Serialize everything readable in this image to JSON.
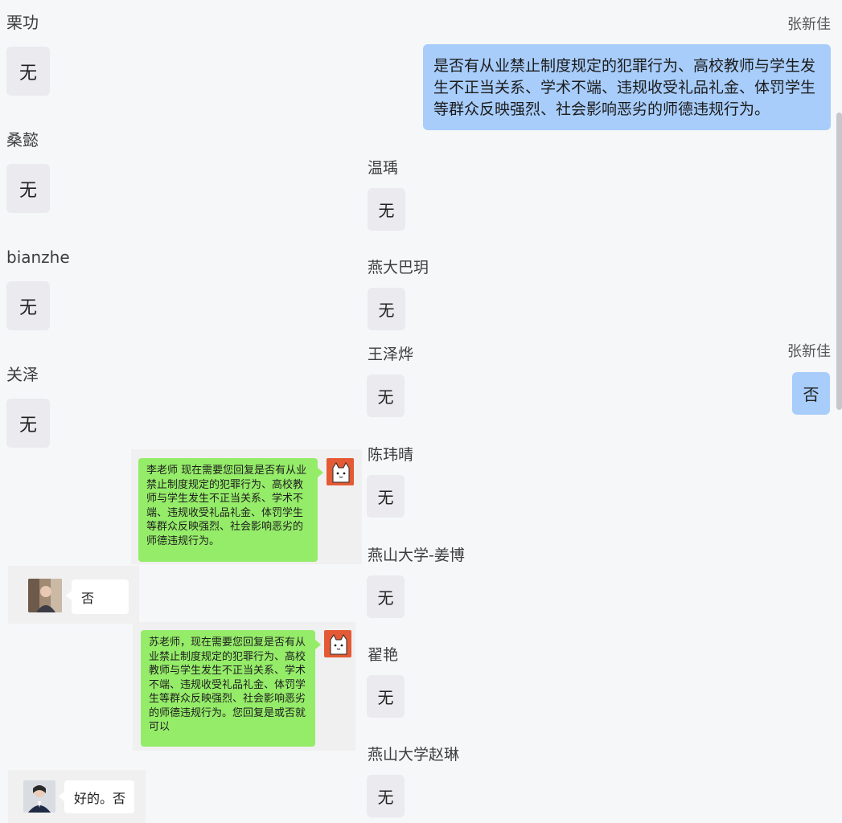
{
  "left_column": [
    {
      "name": "栗功",
      "reply": "无"
    },
    {
      "name": "桑懿",
      "reply": "无"
    },
    {
      "name": "bianzhe",
      "reply": "无"
    },
    {
      "name": "关泽",
      "reply": "无"
    }
  ],
  "middle_column": [
    {
      "name": "温瑀",
      "reply": "无"
    },
    {
      "name": "燕大巴玥",
      "reply": "无"
    },
    {
      "name": "王泽烨",
      "reply": "无"
    },
    {
      "name": "陈玮晴",
      "reply": "无"
    },
    {
      "name": "燕山大学-姜博",
      "reply": "无"
    },
    {
      "name": "翟艳",
      "reply": "无"
    },
    {
      "name": "燕山大学赵琳",
      "reply": "无"
    }
  ],
  "question_message": {
    "sender": "张新佳",
    "text": "是否有从业禁止制度规定的犯罪行为、高校教师与学生发生不正当关系、学术不端、违规收受礼品礼金、体罚学生等群众反映强烈、社会影响恶劣的师德违规行为。"
  },
  "answer_message": {
    "sender": "张新佳",
    "text": "否"
  },
  "screenshot_chats": [
    {
      "outgoing": "李老师 现在需要您回复是否有从业禁止制度规定的犯罪行为、高校教师与学生发生不正当关系、学术不端、违规收受礼品礼金、体罚学生等群众反映强烈、社会影响恶劣的师德违规行为。",
      "incoming": "否"
    },
    {
      "outgoing": "苏老师，现在需要您回复是否有从业禁止制度规定的犯罪行为、高校教师与学生发生不正当关系、学术不端、违规收受礼品礼金、体罚学生等群众反映强烈、社会影响恶劣的师德违规行为。您回复是或否就可以",
      "incoming": "好的。否"
    }
  ]
}
